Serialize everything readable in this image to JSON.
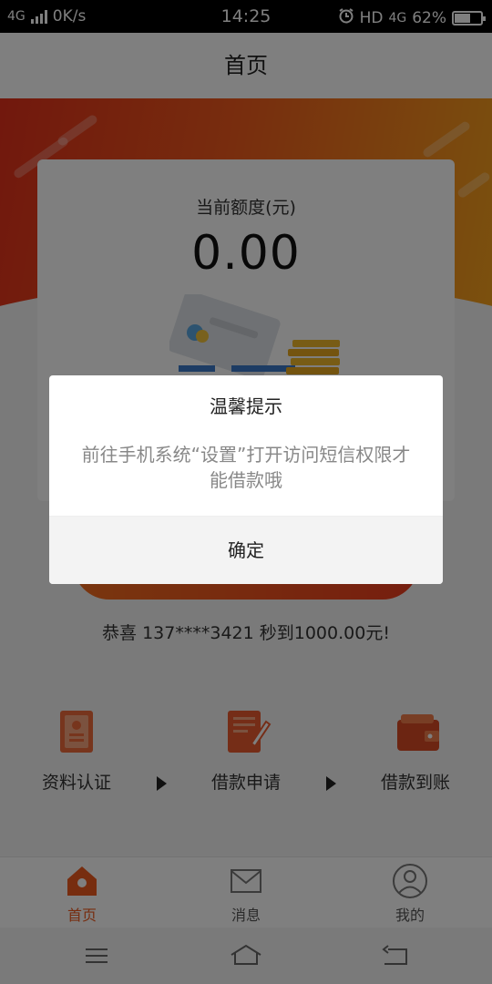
{
  "status_bar": {
    "network": "4G",
    "speed": "0K/s",
    "time": "14:25",
    "hd": "HD",
    "network_right": "4G",
    "battery": "62%",
    "battery_level": 0.62
  },
  "header": {
    "title": "首页"
  },
  "quota": {
    "label": "当前额度(元)",
    "amount": "0.00"
  },
  "congrats": "恭喜 137****3421 秒到1000.00元!",
  "steps": [
    {
      "label": "资料认证",
      "icon": "id-document-icon"
    },
    {
      "label": "借款申请",
      "icon": "application-form-icon"
    },
    {
      "label": "借款到账",
      "icon": "wallet-icon"
    }
  ],
  "tabs": [
    {
      "label": "首页",
      "icon": "home-icon",
      "active": true
    },
    {
      "label": "消息",
      "icon": "mail-icon",
      "active": false
    },
    {
      "label": "我的",
      "icon": "profile-icon",
      "active": false
    }
  ],
  "dialog": {
    "title": "温馨提示",
    "message": "前往手机系统“设置”打开访问短信权限才能借款哦",
    "confirm_label": "确定"
  },
  "colors": {
    "accent": "#ee5a1e",
    "hero_start": "#e4301a",
    "hero_end": "#f6a21c"
  }
}
